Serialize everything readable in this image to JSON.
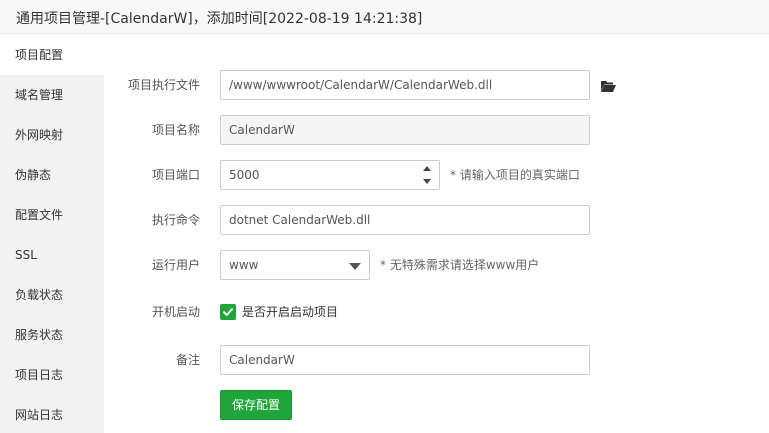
{
  "window": {
    "title": "通用项目管理-[CalendarW]，添加时间[2022-08-19 14:21:38]"
  },
  "sidebar": {
    "items": [
      {
        "label": "项目配置"
      },
      {
        "label": "域名管理"
      },
      {
        "label": "外网映射"
      },
      {
        "label": "伪静态"
      },
      {
        "label": "配置文件"
      },
      {
        "label": "SSL"
      },
      {
        "label": "负载状态"
      },
      {
        "label": "服务状态"
      },
      {
        "label": "项目日志"
      },
      {
        "label": "网站日志"
      }
    ],
    "active_index": 0
  },
  "form": {
    "exec_file": {
      "label": "项目执行文件",
      "value": "/www/wwwroot/CalendarW/CalendarWeb.dll",
      "icon": "folder-open-icon"
    },
    "name": {
      "label": "项目名称",
      "value": "CalendarW"
    },
    "port": {
      "label": "项目端口",
      "value": "5000",
      "hint": "* 请输入项目的真实端口"
    },
    "command": {
      "label": "执行命令",
      "value": "dotnet CalendarWeb.dll"
    },
    "user": {
      "label": "运行用户",
      "value": "www",
      "hint": "* 无特殊需求请选择www用户"
    },
    "autostart": {
      "label": "开机启动",
      "checkbox_label": "是否开启启动项目",
      "checked": true
    },
    "remark": {
      "label": "备注",
      "value": "CalendarW"
    },
    "save_label": "保存配置"
  },
  "colors": {
    "accent": "#20a53a",
    "sidebar_bg": "#f2f2f2",
    "titlebar_bg": "#f8f8f8"
  }
}
